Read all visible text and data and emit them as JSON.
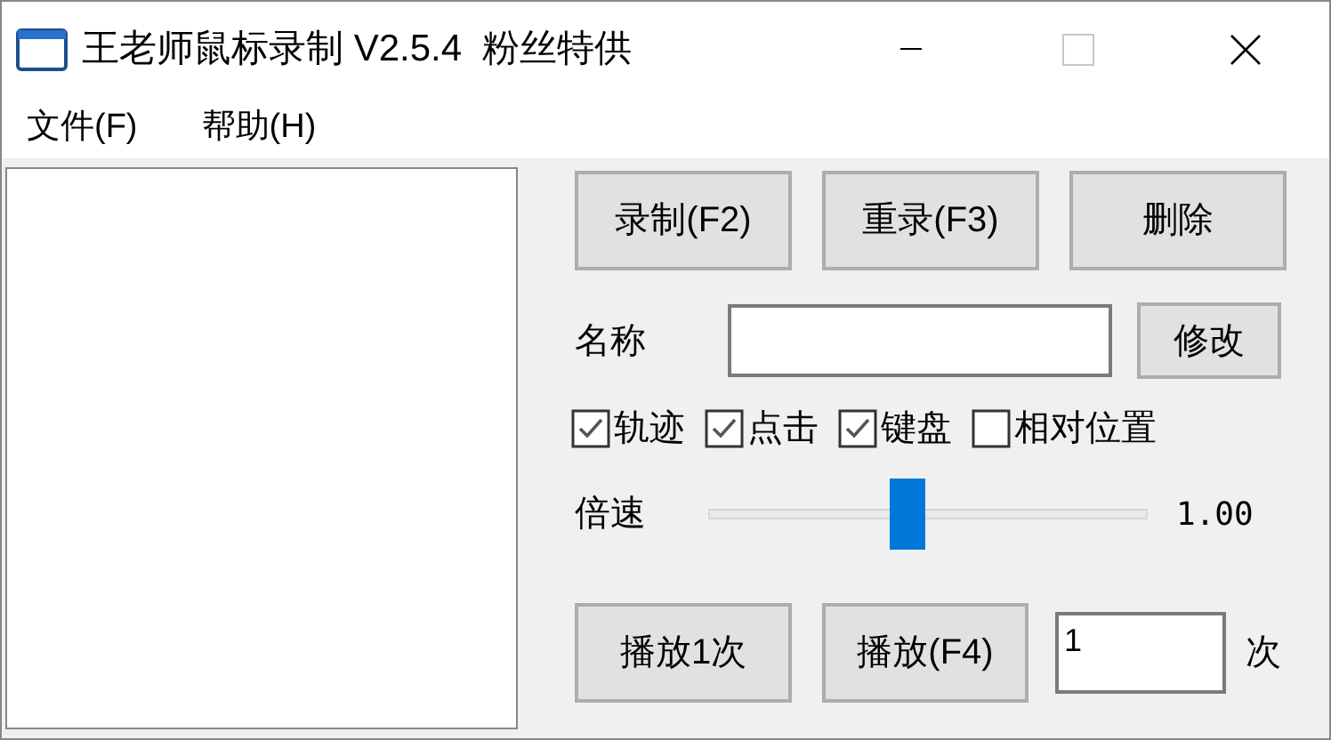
{
  "window": {
    "title": "王老师鼠标录制 V2.5.4  粉丝特供",
    "maximize_disabled": true
  },
  "menu": [
    {
      "label": "文件(F)"
    },
    {
      "label": "帮助(H)"
    }
  ],
  "record_buttons": [
    {
      "label": "录制(F2)"
    },
    {
      "label": "重录(F3)"
    },
    {
      "label": "删除"
    }
  ],
  "name_row": {
    "label": "名称",
    "button": "修改"
  },
  "options": [
    {
      "label": "轨迹",
      "checked": true
    },
    {
      "label": "点击",
      "checked": true
    },
    {
      "label": "键盘",
      "checked": true
    },
    {
      "label": "相对位置",
      "checked": false
    }
  ],
  "speed": {
    "label": "倍速",
    "level": 0.45,
    "reading": "1.00"
  },
  "play": {
    "once_button": "播放1次",
    "play_button": "播放(F4)",
    "count": "1",
    "unit": "次"
  }
}
